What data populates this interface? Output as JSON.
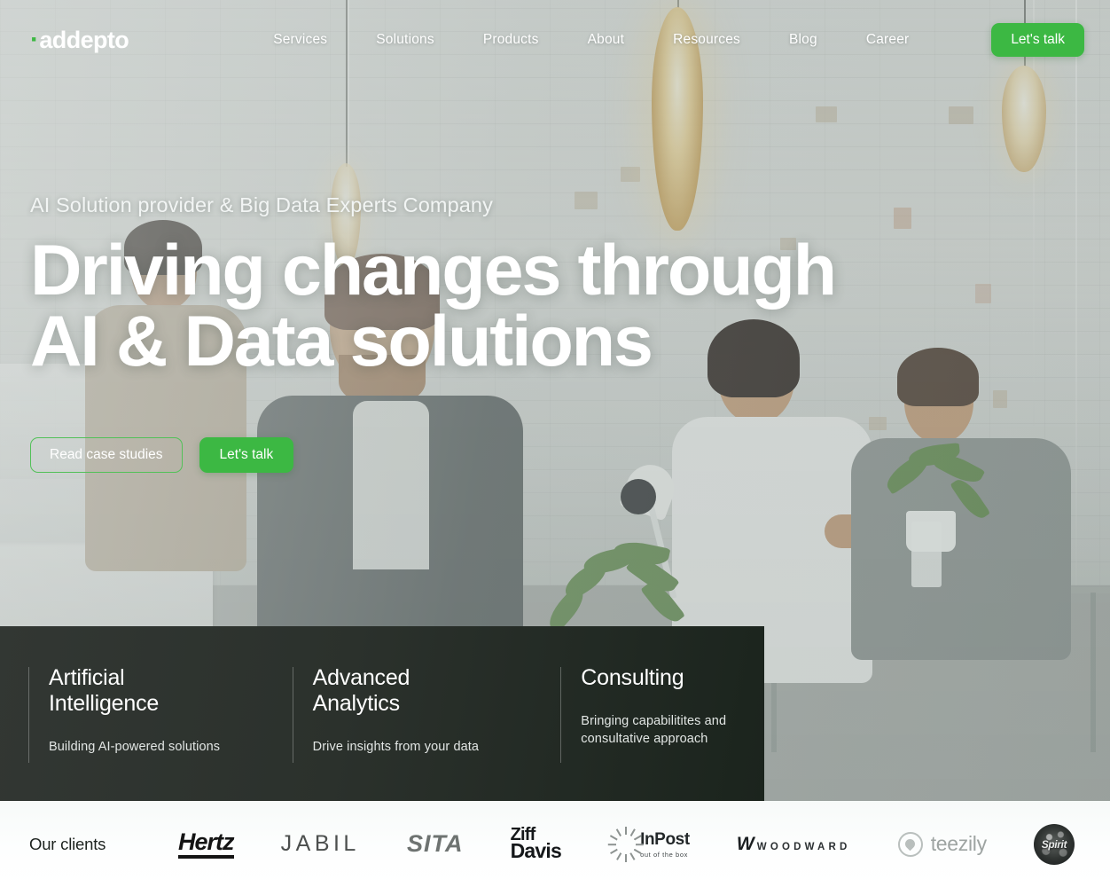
{
  "brand": {
    "dot": "·",
    "name": "addepto"
  },
  "nav": {
    "items": [
      {
        "label": "Services",
        "name": "nav-link-services"
      },
      {
        "label": "Solutions",
        "name": "nav-link-solutions"
      },
      {
        "label": "Products",
        "name": "nav-link-products"
      },
      {
        "label": "About",
        "name": "nav-link-about"
      },
      {
        "label": "Resources",
        "name": "nav-link-resources"
      },
      {
        "label": "Blog",
        "name": "nav-link-blog"
      },
      {
        "label": "Career",
        "name": "nav-link-career"
      }
    ],
    "cta_label": "Let's talk"
  },
  "hero": {
    "eyebrow": "AI Solution provider & Big Data Experts Company",
    "headline_line1": "Driving changes through",
    "headline_line2": "AI & Data solutions",
    "btn_outline_label": "Read case studies",
    "btn_solid_label": "Let's talk"
  },
  "cards": [
    {
      "title_line1": "Artificial",
      "title_line2": "Intelligence",
      "desc": "Building AI-powered solutions"
    },
    {
      "title_line1": "Advanced",
      "title_line2": "Analytics",
      "desc": "Drive insights from your data"
    },
    {
      "title_line1": "Consulting",
      "title_line2": "",
      "desc": "Bringing capabilitites and consultative approach"
    }
  ],
  "clients": {
    "label": "Our clients",
    "logos": [
      {
        "name": "hertz",
        "text": "Hertz"
      },
      {
        "name": "jabil",
        "text": "JABIL"
      },
      {
        "name": "sita",
        "text": "SITA"
      },
      {
        "name": "ziffdavis",
        "text_line1": "Ziff",
        "text_line2": "Davis"
      },
      {
        "name": "inpost",
        "text": "InPost",
        "tagline": "out of the box"
      },
      {
        "name": "woodward",
        "mark": "W",
        "text": "WOODWARD"
      },
      {
        "name": "teezily",
        "text": "teezily"
      },
      {
        "name": "spirit",
        "text": "Spirit"
      }
    ]
  },
  "colors": {
    "accent_green": "#3cb843",
    "dark_panel": "#1b241d",
    "clients_bg": "#f7faf9"
  }
}
